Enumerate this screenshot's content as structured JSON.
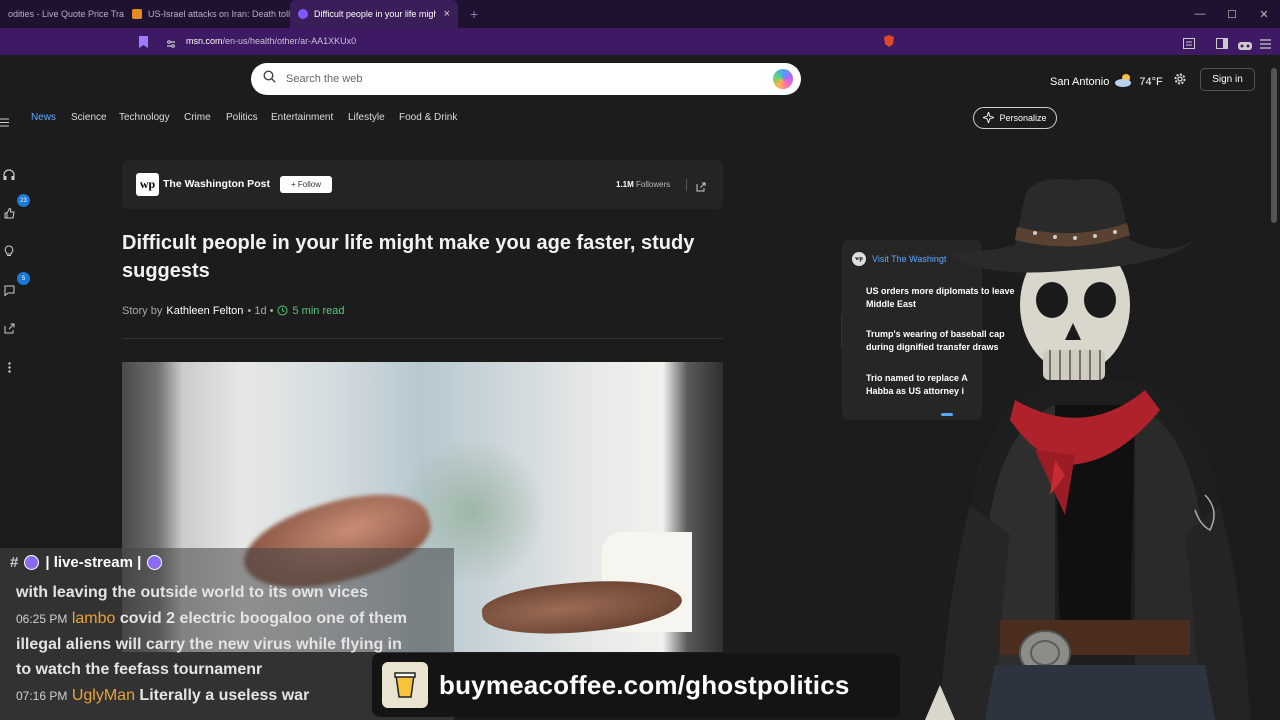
{
  "browser": {
    "tabs": [
      {
        "title": "odities - Live Quote Price Trac",
        "favicon_color": "#2c2c2c"
      },
      {
        "title": "US-Israel attacks on Iran: Death toll a",
        "favicon_color": "#e38b24"
      },
      {
        "title": "Difficult people in your life migh",
        "favicon_color": "#7c5cff",
        "active": true
      }
    ],
    "new_tab_symbol": "+",
    "close_symbol": "×",
    "url_domain": "msn.com",
    "url_path": "/en-us/health/other/ar-AA1XKUx0"
  },
  "header": {
    "search_placeholder": "Search the web",
    "location": "San Antonio",
    "temperature": "74°F",
    "signin_label": "Sign in"
  },
  "nav": {
    "items": [
      "News",
      "Science",
      "Technology",
      "Crime",
      "Politics",
      "Entertainment",
      "Lifestyle",
      "Food & Drink"
    ],
    "active": "News",
    "personalize_label": "Personalize"
  },
  "rail": {
    "badges": {
      "likes": "23",
      "comments": "5"
    }
  },
  "article": {
    "publisher": "The Washington Post",
    "publisher_logo": "wp",
    "follow_label": "+ Follow",
    "followers_count": "1.1M",
    "followers_label": "Followers",
    "headline": "Difficult people in your life might make you age faster, study suggests",
    "story_by": "Story by",
    "author": "Kathleen Felton",
    "age": "• 1d •",
    "read_time": "5 min read"
  },
  "panel": {
    "title": "Visit The Washingt",
    "items": [
      "US orders more diplomats to leave Middle East",
      "Trump's wearing of baseball cap during dignified transfer draws",
      "Trio named to replace A Habba as US attorney i"
    ]
  },
  "chat": {
    "channel": "| live-stream |",
    "lines": [
      {
        "time": "",
        "user": "",
        "text": "with leaving the outside world to its own vices"
      },
      {
        "time": "06:25 PM",
        "user": "lambo",
        "text": "covid 2 electric boogaloo one of them"
      },
      {
        "time": "",
        "user": "",
        "text": "illegal aliens will carry the new virus while flying in"
      },
      {
        "time": "",
        "user": "",
        "text": "to watch the feefass tournamenr"
      },
      {
        "time": "07:16 PM",
        "user": "UglyMan",
        "text": "Literally a useless war"
      }
    ]
  },
  "promo": {
    "text": "buymeacoffee.com/ghostpolitics"
  },
  "colors": {
    "accent": "#5aa7ff",
    "tab_bar": "#1f1230",
    "address_bar": "#3d1a63",
    "page_bg": "#1c1c1c",
    "read_time": "#52c97c",
    "chat_user": "#e7a33b"
  }
}
